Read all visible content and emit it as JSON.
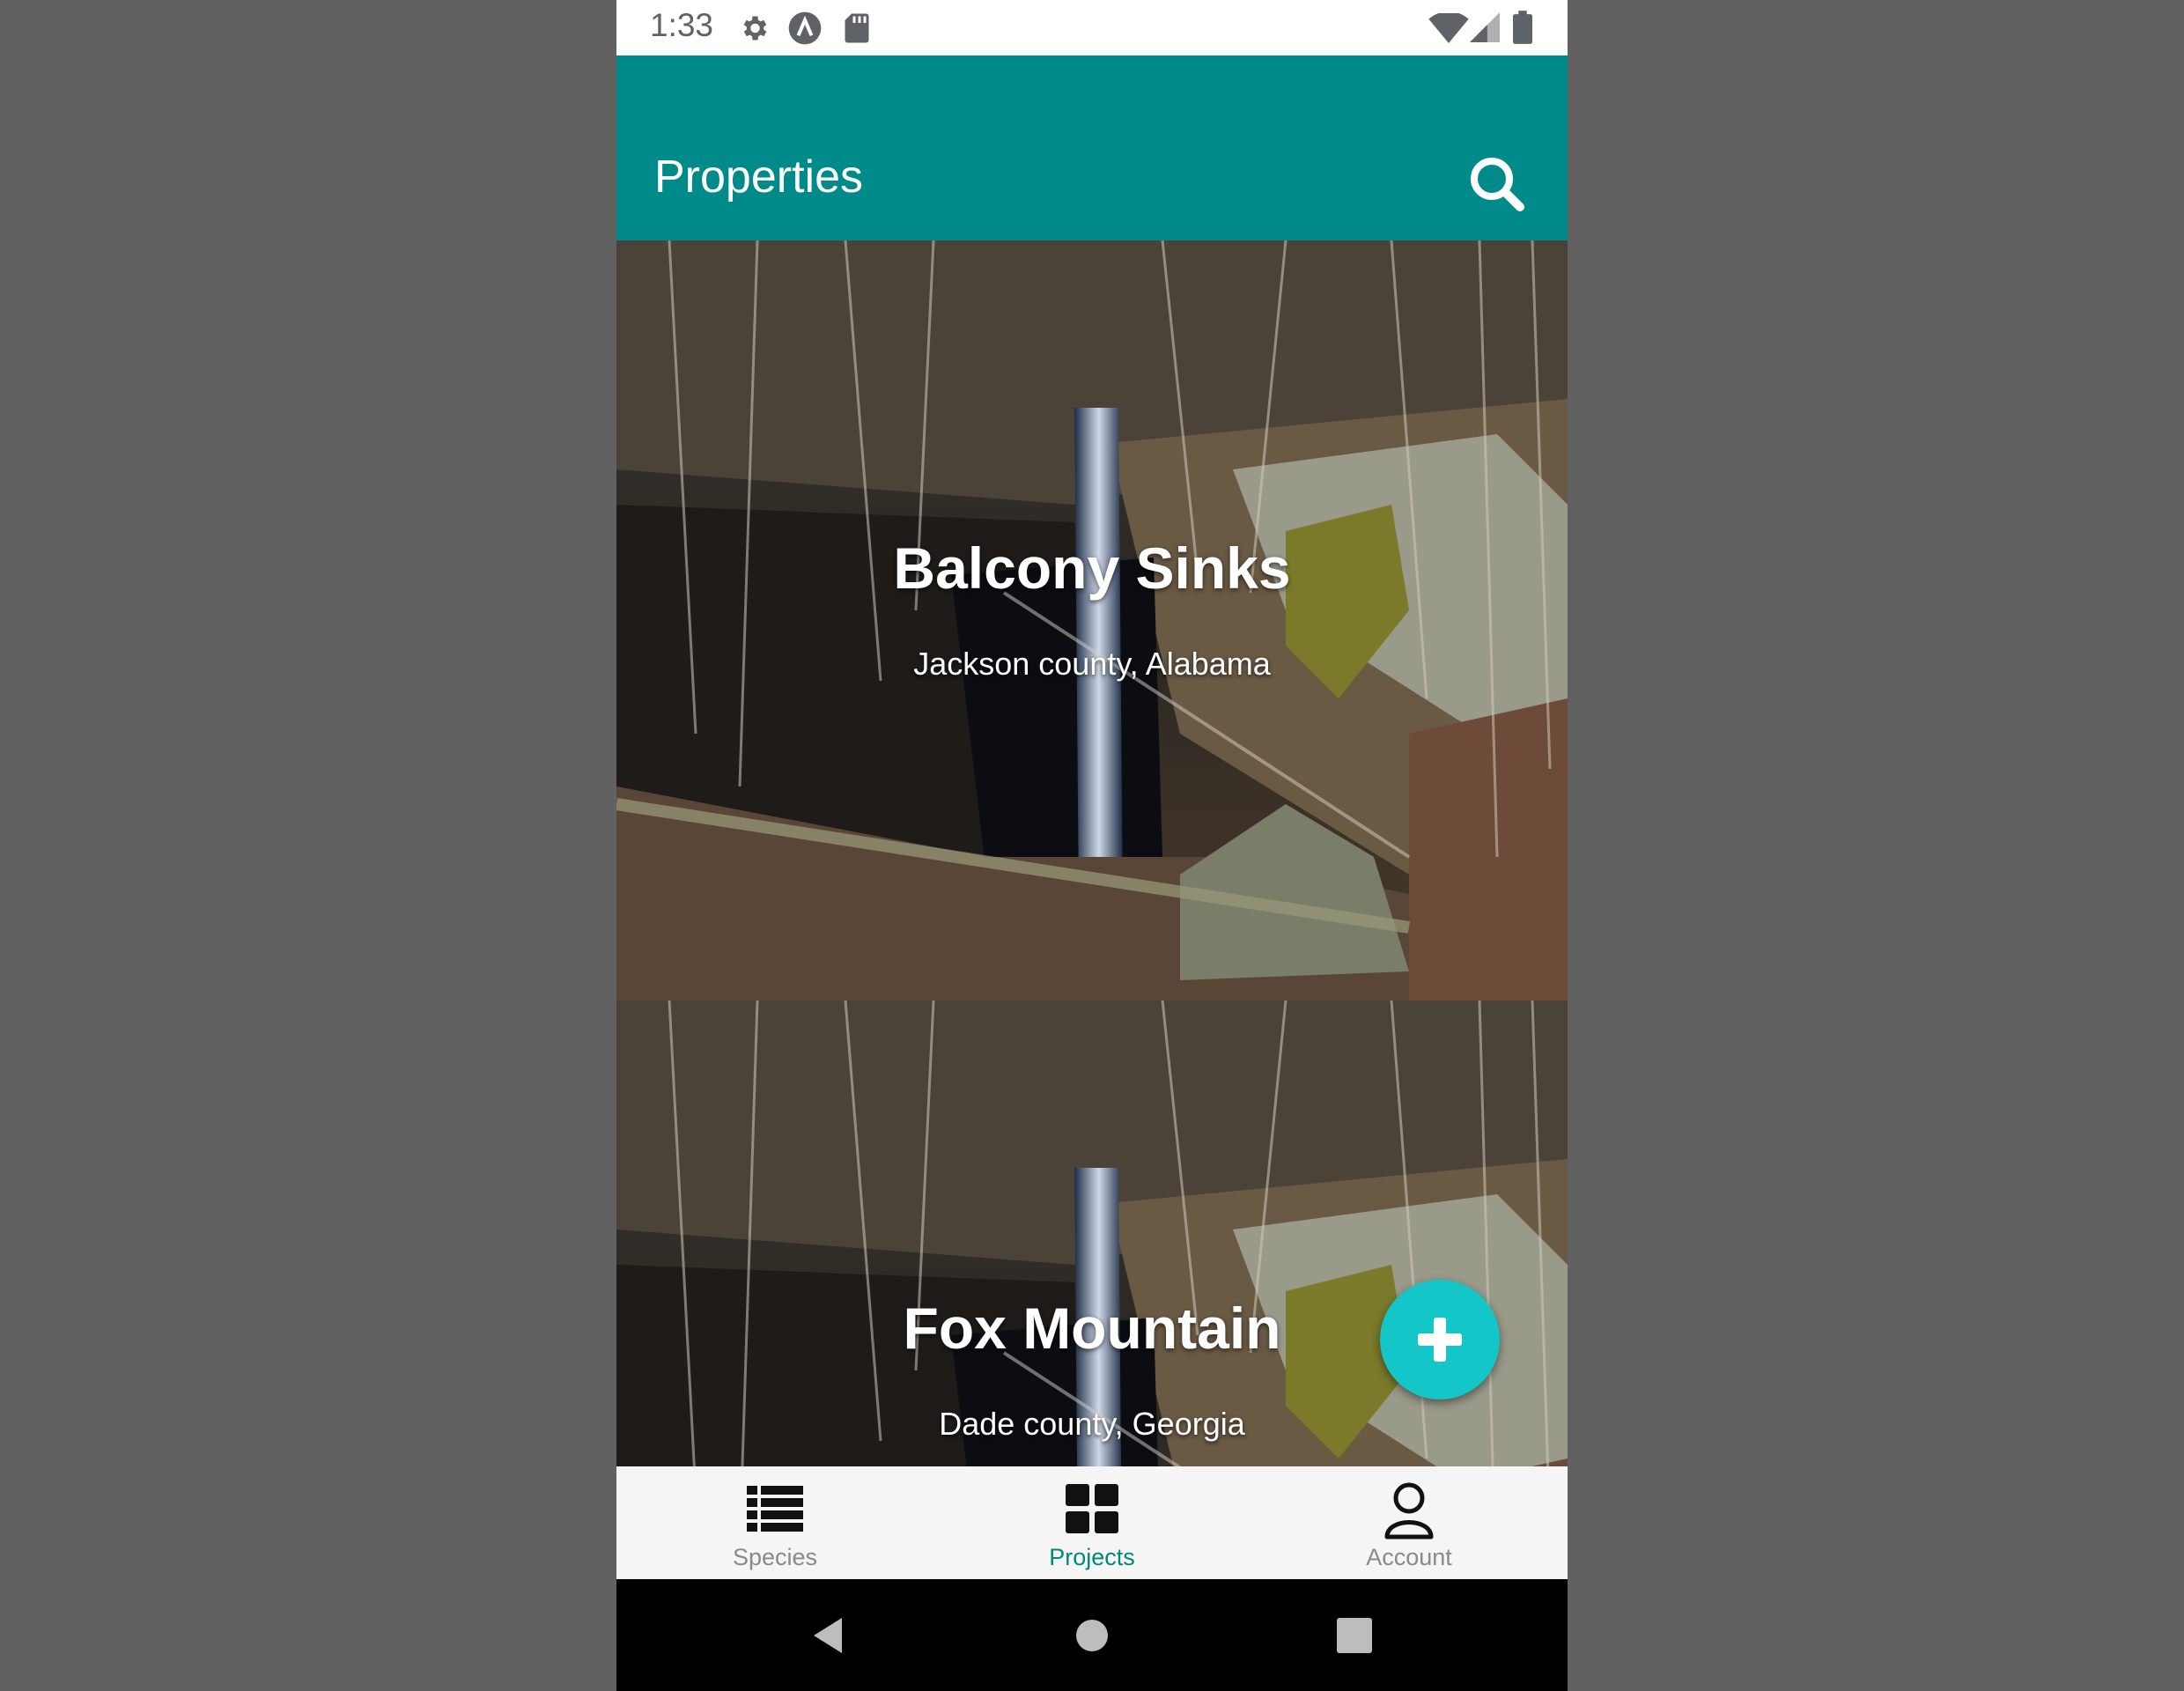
{
  "status_bar": {
    "time": "1:33",
    "icons": [
      "settings-icon",
      "sync-icon",
      "sd-card-icon",
      "wifi-icon",
      "signal-icon",
      "battery-icon"
    ]
  },
  "app_bar": {
    "title": "Properties",
    "action_icon": "search-icon"
  },
  "properties": [
    {
      "name": "Balcony Sinks",
      "location": "Jackson county, Alabama"
    },
    {
      "name": "Fox Mountain",
      "location": "Dade county, Georgia"
    }
  ],
  "fab": {
    "icon": "plus-icon"
  },
  "bottom_nav": {
    "items": [
      {
        "label": "Species",
        "icon": "list-icon",
        "active": false
      },
      {
        "label": "Projects",
        "icon": "grid-icon",
        "active": true
      },
      {
        "label": "Account",
        "icon": "person-icon",
        "active": false
      }
    ]
  },
  "system_nav": [
    "back-icon",
    "home-icon",
    "recents-icon"
  ],
  "colors": {
    "primary": "#008b8a",
    "accent": "#14c6c8",
    "active_nav": "#00897b",
    "inactive_nav": "#8a8a8a",
    "background": "#616161"
  }
}
